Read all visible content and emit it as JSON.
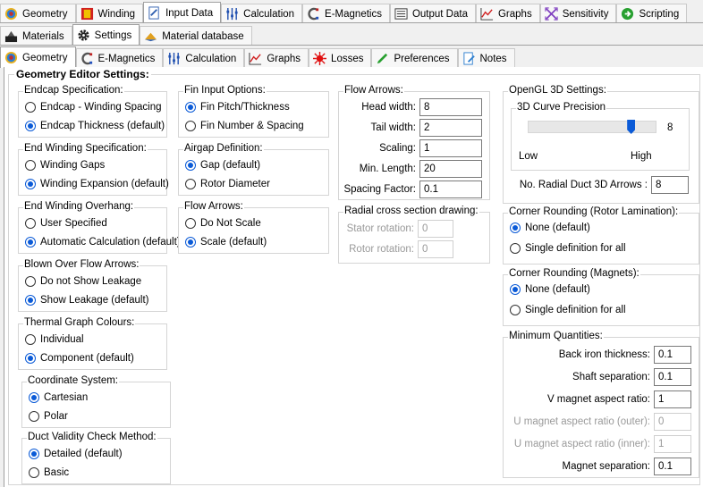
{
  "tabs_top": [
    {
      "label": "Geometry",
      "icon": "geometry-icon"
    },
    {
      "label": "Winding",
      "icon": "winding-icon"
    },
    {
      "label": "Input Data",
      "icon": "input-data-icon",
      "active": true
    },
    {
      "label": "Calculation",
      "icon": "calculation-icon"
    },
    {
      "label": "E-Magnetics",
      "icon": "emagnetics-icon"
    },
    {
      "label": "Output Data",
      "icon": "output-data-icon"
    },
    {
      "label": "Graphs",
      "icon": "graphs-icon"
    },
    {
      "label": "Sensitivity",
      "icon": "sensitivity-icon"
    },
    {
      "label": "Scripting",
      "icon": "scripting-icon"
    }
  ],
  "tabs_second": [
    {
      "label": "Materials",
      "icon": "materials-icon"
    },
    {
      "label": "Settings",
      "icon": "settings-gear-icon",
      "active": true
    },
    {
      "label": "Material database",
      "icon": "material-database-icon"
    }
  ],
  "tabs_third": [
    {
      "label": "Geometry",
      "icon": "geometry-icon",
      "active": true
    },
    {
      "label": "E-Magnetics",
      "icon": "emagnetics-icon"
    },
    {
      "label": "Calculation",
      "icon": "calculation-icon"
    },
    {
      "label": "Graphs",
      "icon": "graphs-icon"
    },
    {
      "label": "Losses",
      "icon": "losses-icon"
    },
    {
      "label": "Preferences",
      "icon": "preferences-icon"
    },
    {
      "label": "Notes",
      "icon": "notes-icon"
    }
  ],
  "page_title": "Geometry Editor Settings:",
  "groups": {
    "endcap": {
      "title": "Endcap Specification:",
      "options": [
        "Endcap - Winding Spacing",
        "Endcap Thickness (default)"
      ],
      "selected": 1
    },
    "end_winding": {
      "title": "End Winding Specification:",
      "options": [
        "Winding Gaps",
        "Winding Expansion (default)"
      ],
      "selected": 1
    },
    "overhang": {
      "title": "End Winding Overhang:",
      "options": [
        "User Specified",
        "Automatic Calculation (default)"
      ],
      "selected": 1
    },
    "blown": {
      "title": "Blown Over Flow Arrows:",
      "options": [
        "Do not Show Leakage",
        "Show Leakage (default)"
      ],
      "selected": 1
    },
    "thermal": {
      "title": "Thermal Graph Colours:",
      "options": [
        "Individual",
        "Component (default)"
      ],
      "selected": 1
    },
    "coord": {
      "title": "Coordinate System:",
      "options": [
        "Cartesian",
        "Polar"
      ],
      "selected": 0
    },
    "duct": {
      "title": "Duct Validity Check Method:",
      "options": [
        "Detailed (default)",
        "Basic"
      ],
      "selected": 0
    },
    "fin": {
      "title": "Fin Input Options:",
      "options": [
        "Fin Pitch/Thickness",
        "Fin Number & Spacing"
      ],
      "selected": 0
    },
    "airgap": {
      "title": "Airgap Definition:",
      "options": [
        "Gap (default)",
        "Rotor Diameter"
      ],
      "selected": 0
    },
    "flow_arrows_opt": {
      "title": "Flow Arrows:",
      "options": [
        "Do Not Scale",
        "Scale (default)"
      ],
      "selected": 1
    },
    "corner_rotor": {
      "title": "Corner Rounding (Rotor Lamination):",
      "options": [
        "None (default)",
        "Single definition for all"
      ],
      "selected": 0
    },
    "corner_magnets": {
      "title": "Corner Rounding (Magnets):",
      "options": [
        "None (default)",
        "Single definition for all"
      ],
      "selected": 0
    }
  },
  "flow_arrows": {
    "title": "Flow Arrows:",
    "fields": [
      {
        "label": "Head width:",
        "value": "8"
      },
      {
        "label": "Tail width:",
        "value": "2"
      },
      {
        "label": "Scaling:",
        "value": "1"
      },
      {
        "label": "Min. Length:",
        "value": "20"
      },
      {
        "label": "Spacing Factor:",
        "value": "0.1"
      }
    ]
  },
  "radial": {
    "title": "Radial cross section drawing:",
    "fields": [
      {
        "label": "Stator rotation:",
        "value": "0"
      },
      {
        "label": "Rotor rotation:",
        "value": "0"
      }
    ]
  },
  "opengl": {
    "title": "OpenGL 3D Settings:",
    "curve_title": "3D Curve Precision",
    "curve_value": "8",
    "slider_fraction": 0.8,
    "low": "Low",
    "high": "High",
    "duct_label": "No. Radial Duct 3D Arrows :",
    "duct_value": "8"
  },
  "min_quant": {
    "title": "Minimum Quantities:",
    "fields": [
      {
        "label": "Back iron thickness:",
        "value": "0.1",
        "disabled": false
      },
      {
        "label": "Shaft separation:",
        "value": "0.1",
        "disabled": false
      },
      {
        "label": "V magnet aspect ratio:",
        "value": "1",
        "disabled": false
      },
      {
        "label": "U magnet aspect ratio (outer):",
        "value": "0",
        "disabled": true
      },
      {
        "label": "U magnet aspect ratio (inner):",
        "value": "1",
        "disabled": true
      },
      {
        "label": "Magnet separation:",
        "value": "0.1",
        "disabled": false
      }
    ]
  },
  "colors": {
    "accent": "#0a5ad7"
  }
}
